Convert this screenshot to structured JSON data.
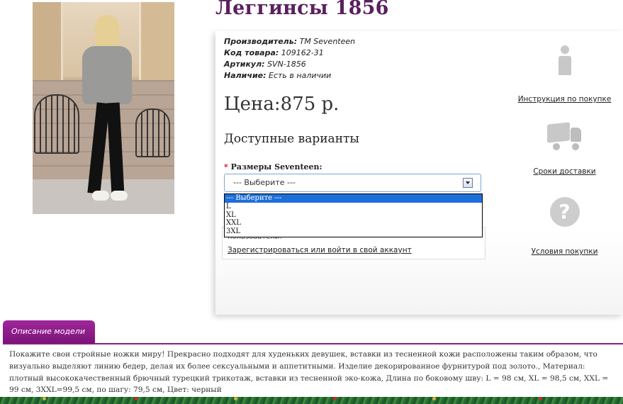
{
  "product": {
    "title": "Леггинсы 1856",
    "image_alt": "Леггинсы 1856"
  },
  "meta": [
    {
      "label": "Производитель:",
      "value": "TM Seventeen"
    },
    {
      "label": "Код товара:",
      "value": "109162-31"
    },
    {
      "label": "Артикул:",
      "value": "SVN-1856"
    },
    {
      "label": "Наличие:",
      "value": "Есть в наличии"
    }
  ],
  "price": "Цена:875 р.",
  "variants_heading": "Доступные варианты",
  "size": {
    "required_mark": "*",
    "label": "Размеры Seventeen:",
    "selected": "--- Выберите ---",
    "options": [
      "--- Выберите ---",
      "L",
      "XL",
      "XXL",
      "3XL"
    ]
  },
  "notice": {
    "text": "пользователи!",
    "link": "Зарегистрироваться или войти в свой аккаунт"
  },
  "info": {
    "instruction": "Инструкция по покупке",
    "delivery": "Сроки доставки",
    "conditions": "Условия покупки"
  },
  "description": {
    "tab_label": "Описание модели",
    "text": "Покажите свои стройные ножки миру! Прекрасно подходят для худеньких девушек, вставки из тесненной кожи расположены таким образом, что визуально выделяют линию бедер, делая их более сексуальными и аппетитными. Изделие декорированное фурнитурой под золото., Материал: плотный высококачественный брючный турецкий трикотаж, вставки из тесненной эко-кожа, Длина по боковому шву: L = 98 см, XL = 98,5 см, XXL = 99 см, 3XXL=99,5 см, по шагу: 79,5 см, Цвет: черный"
  },
  "colors": {
    "title": "#5a1f5e",
    "tab": "#8a1a86",
    "selected_option": "#1e6fd9",
    "required": "#d0121b",
    "icon": "#c8c8c8"
  }
}
